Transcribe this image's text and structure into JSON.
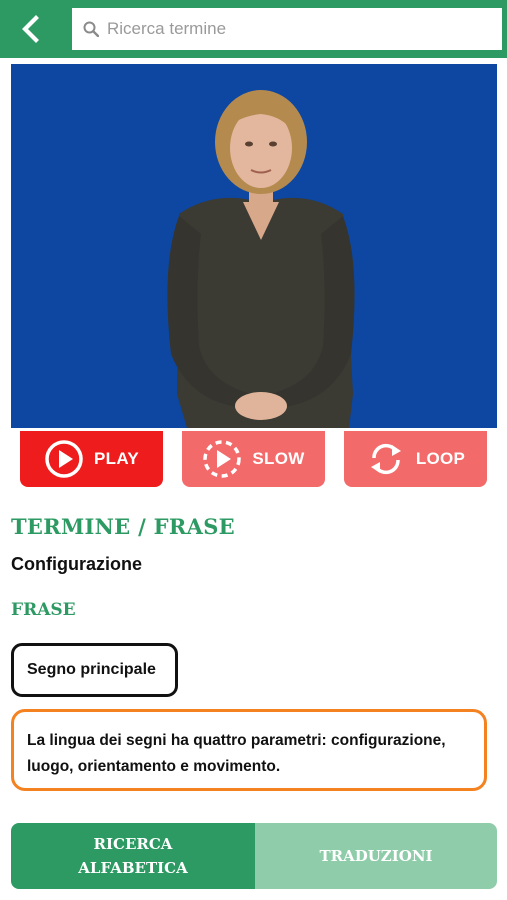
{
  "header": {
    "search_placeholder": "Ricerca termine",
    "back_icon": "chevron-left-icon",
    "search_icon": "search-icon",
    "brand_color": "#2e9a63"
  },
  "video": {
    "background_color": "#0d47a1",
    "content": "signer-woman"
  },
  "controls": [
    {
      "label": "PLAY",
      "icon": "play-circle-icon",
      "color": "#ee1c1c"
    },
    {
      "label": "SLOW",
      "icon": "slow-play-icon",
      "color": "#f36a6a"
    },
    {
      "label": "LOOP",
      "icon": "loop-icon",
      "color": "#f36a6a"
    }
  ],
  "content": {
    "title": "TERMINE / FRASE",
    "subtitle": "Configurazione",
    "section": "FRASE",
    "tag": "Segno principale",
    "description": "La lingua dei segni ha quattro parametri: configurazione, luogo, orientamento e movimento."
  },
  "tabs": [
    {
      "label": "RICERCA ALFABETICA",
      "active": true
    },
    {
      "label": "TRADUZIONI",
      "active": false
    }
  ]
}
